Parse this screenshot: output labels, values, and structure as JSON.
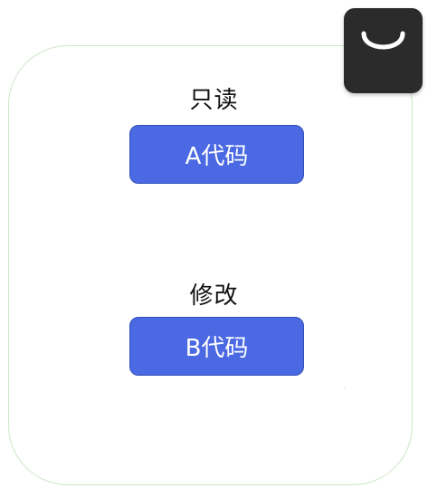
{
  "labels": {
    "readonly": "只读",
    "modify": "修改"
  },
  "buttons": {
    "code_a": "A代码",
    "code_b": "B代码"
  },
  "icons": {
    "corner_badge": "shopping-bag-icon"
  },
  "colors": {
    "button_fill": "#4a69e2",
    "frame_border": "#cfe6c9",
    "badge_fill": "#2b2b2b"
  }
}
